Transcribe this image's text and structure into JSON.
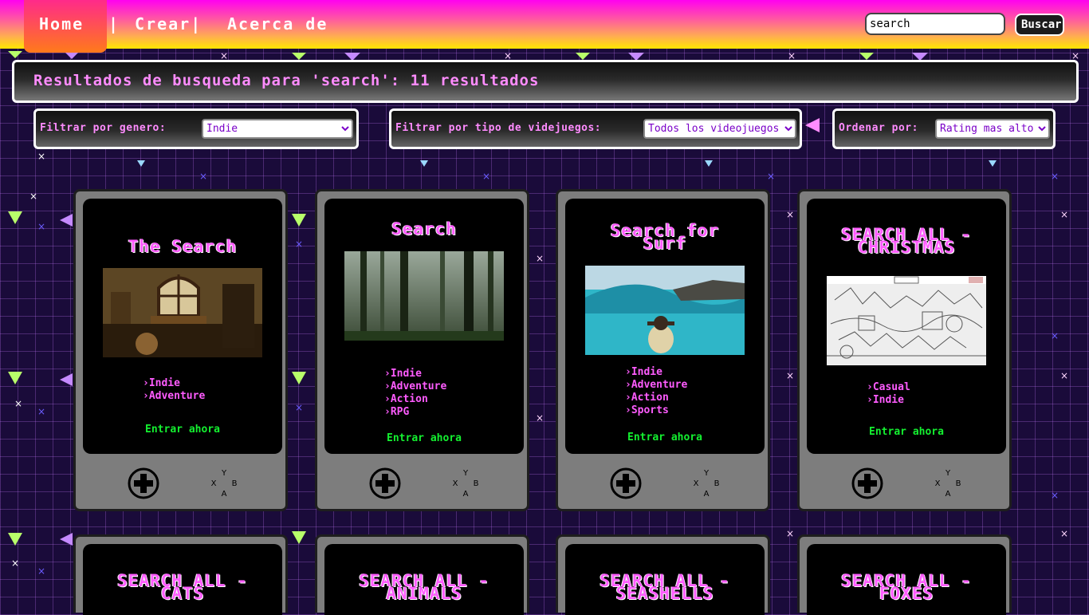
{
  "nav": {
    "home": "Home",
    "sep": "|",
    "crear": "Crear|",
    "about": "Acerca de",
    "search_value": "search",
    "search_button": "Buscar"
  },
  "results": {
    "text": "Resultados de busqueda para 'search': 11 resultados"
  },
  "filters": {
    "genre_label": "Filtrar por genero:",
    "genre_value": "Indie",
    "type_label": "Filtrar por tipo de videjuegos:",
    "type_value": "Todos los videojuegos",
    "sort_label": "Ordenar por:",
    "sort_value": "Rating mas alto"
  },
  "cards": [
    {
      "title_1": "The Search",
      "title_2": "",
      "genres": [
        "Indie",
        "Adventure"
      ],
      "enter": "Entrar ahora"
    },
    {
      "title_1": "Search",
      "title_2": "",
      "genres": [
        "Indie",
        "Adventure",
        "Action",
        "RPG"
      ],
      "enter": "Entrar ahora"
    },
    {
      "title_1": "Search for",
      "title_2": "Surf",
      "genres": [
        "Indie",
        "Adventure",
        "Action",
        "Sports"
      ],
      "enter": "Entrar ahora"
    },
    {
      "title_1": "SEARCH ALL -",
      "title_2": "CHRISTMAS",
      "genres": [
        "Casual",
        "Indie"
      ],
      "enter": "Entrar ahora"
    },
    {
      "title_1": "SEARCH ALL -",
      "title_2": "CATS"
    },
    {
      "title_1": "SEARCH ALL -",
      "title_2": "ANIMALS"
    },
    {
      "title_1": "SEARCH ALL -",
      "title_2": "SEASHELLS"
    },
    {
      "title_1": "SEARCH ALL -",
      "title_2": "FOXES"
    }
  ],
  "buttons": {
    "y": "Y",
    "x": "X",
    "b": "B",
    "a": "A"
  }
}
